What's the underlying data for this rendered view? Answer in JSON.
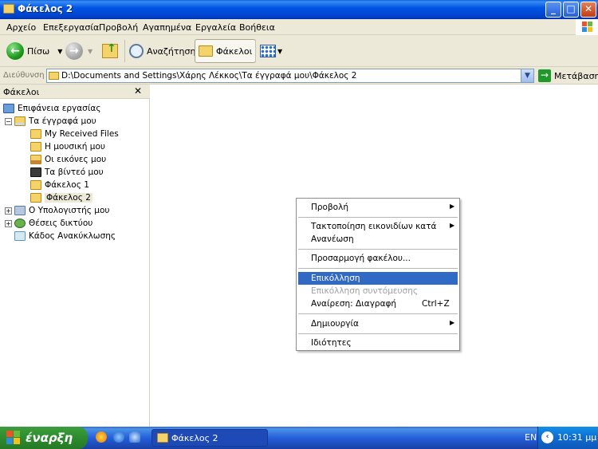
{
  "window": {
    "title": "Φάκελος 2",
    "controls": {
      "minimize": "_",
      "maximize": "□",
      "close": "✕"
    }
  },
  "menubar": {
    "items": [
      "Αρχείο",
      "Επεξεργασία",
      "Προβολή",
      "Αγαπημένα",
      "Εργαλεία",
      "Βοήθεια"
    ]
  },
  "toolbar": {
    "back_label": "Πίσω",
    "search_label": "Αναζήτηση",
    "folders_label": "Φάκελοι"
  },
  "address": {
    "label": "Διεύθυνση",
    "value": "D:\\Documents and Settings\\Χάρης Λέκκος\\Τα έγγραφά μου\\Φάκελος 2",
    "go_label": "Μετάβαση"
  },
  "folders_pane": {
    "title": "Φάκελοι",
    "close": "✕",
    "items": [
      {
        "label": "Επιφάνεια εργασίας",
        "icon": "desktop-icon"
      },
      {
        "label": "Τα έγγραφά μου",
        "icon": "my-documents-icon",
        "expander": "−"
      },
      {
        "label": "My Received Files",
        "icon": "folder-icon"
      },
      {
        "label": "Η μουσική μου",
        "icon": "music-folder-icon"
      },
      {
        "label": "Οι εικόνες μου",
        "icon": "pictures-folder-icon"
      },
      {
        "label": "Τα βίντεό μου",
        "icon": "video-folder-icon"
      },
      {
        "label": "Φάκελος 1",
        "icon": "folder-icon"
      },
      {
        "label": "Φάκελος 2",
        "icon": "folder-icon"
      },
      {
        "label": "Ο Υπολογιστής μου",
        "icon": "computer-icon",
        "expander": "+"
      },
      {
        "label": "Θέσεις δικτύου",
        "icon": "network-icon",
        "expander": "+"
      },
      {
        "label": "Κάδος Ανακύκλωσης",
        "icon": "recycle-bin-icon"
      }
    ]
  },
  "context_menu": {
    "items": [
      {
        "label": "Προβολή",
        "submenu": true
      },
      {
        "label": "Τακτοποίηση εικονιδίων κατά",
        "submenu": true
      },
      {
        "label": "Ανανέωση"
      },
      {
        "label": "Προσαρμογή φακέλου..."
      },
      {
        "label": "Επικόλληση",
        "highlighted": true
      },
      {
        "label": "Επικόλληση συντόμευσης",
        "disabled": true
      },
      {
        "label": "Αναίρεση: Διαγραφή",
        "shortcut": "Ctrl+Z"
      },
      {
        "label": "Δημιουργία",
        "submenu": true
      },
      {
        "label": "Ιδιότητες"
      }
    ],
    "submenu_arrow": "▶"
  },
  "taskbar": {
    "start_label": "έναρξη",
    "task_label": "Φάκελος 2",
    "language": "EN",
    "clock": "10:31 μμ",
    "tray_chevron": "‹"
  },
  "colors": {
    "titlebar": "#0055e5",
    "menu_highlight": "#316ac5",
    "taskbar": "#245edb",
    "start_button": "#2e8b2e"
  }
}
